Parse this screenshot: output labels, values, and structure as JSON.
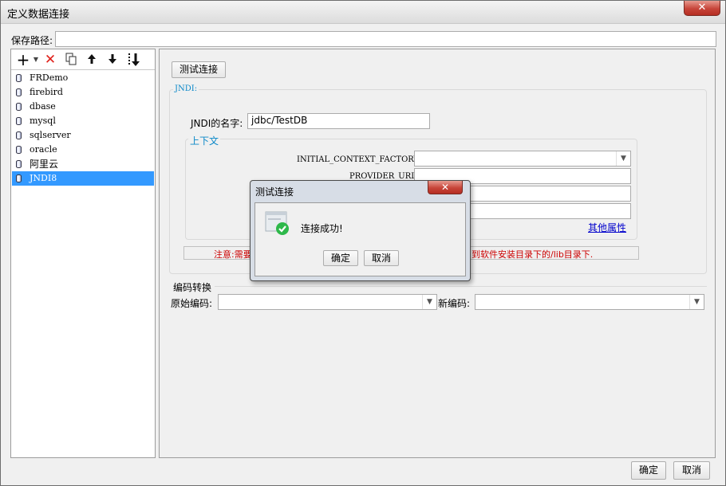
{
  "window": {
    "title": "定义数据连接",
    "close_symbol": "✕"
  },
  "save_path": {
    "label": "保存路径:",
    "value": ""
  },
  "toolbar": {
    "icons": [
      "add-icon",
      "delete-icon",
      "copy-icon",
      "move-up-icon",
      "move-down-icon",
      "sort-icon"
    ]
  },
  "tree": {
    "items": [
      {
        "label": "FRDemo",
        "selected": false
      },
      {
        "label": "firebird",
        "selected": false
      },
      {
        "label": "dbase",
        "selected": false
      },
      {
        "label": "mysql",
        "selected": false
      },
      {
        "label": "sqlserver",
        "selected": false
      },
      {
        "label": "oracle",
        "selected": false
      },
      {
        "label": "阿里云",
        "selected": false
      },
      {
        "label": "JNDI8",
        "selected": true
      }
    ]
  },
  "main": {
    "test_button": "测试连接",
    "jndi_group_label": "JNDI:",
    "jndi_name_label": "JNDI的名字:",
    "jndi_name_value": "jdbc/TestDB",
    "context_group_label": "上下文",
    "initial_context_factory_label": "INITIAL_CONTEXT_FACTORY:",
    "initial_context_factory_value": "",
    "provider_url_label": "PROVIDER_URL:",
    "provider_url_value": "",
    "other_properties_link": "其他属性",
    "note_left": "注意:需要",
    "note_right": "到软件安装目录下的/lib目录下.",
    "encoding_group_label": "编码转换",
    "original_encoding_label": "原始编码:",
    "original_encoding_value": "",
    "new_encoding_label": "新编码:",
    "new_encoding_value": ""
  },
  "footer": {
    "ok_button": "确定",
    "cancel_button": "取消"
  },
  "dialog": {
    "title": "测试连接",
    "close_symbol": "✕",
    "message": "连接成功!",
    "ok_button": "确定",
    "cancel_button": "取消",
    "status_color": "#2db84a"
  }
}
